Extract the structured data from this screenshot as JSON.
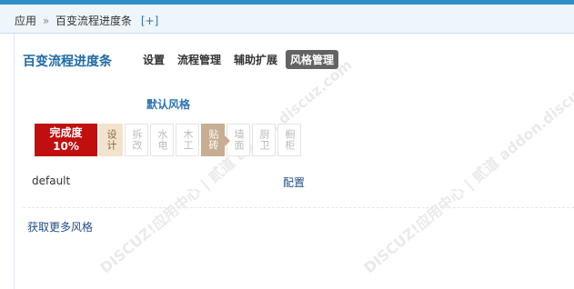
{
  "breadcrumb": {
    "root": "应用",
    "separator": "»",
    "current": "百变流程进度条",
    "add": "[+]"
  },
  "page_title": "百变流程进度条",
  "tabs": [
    {
      "label": "设置",
      "active": false
    },
    {
      "label": "流程管理",
      "active": false
    },
    {
      "label": "辅助扩展",
      "active": false
    },
    {
      "label": "风格管理",
      "active": true
    }
  ],
  "style_section": {
    "title": "默认风格",
    "progress_label": "完成度",
    "progress_value": "10%",
    "steps": [
      {
        "label": "设计",
        "state": "done"
      },
      {
        "label": "拆改",
        "state": "todo"
      },
      {
        "label": "水电",
        "state": "todo"
      },
      {
        "label": "木工",
        "state": "todo"
      },
      {
        "label": "贴砖",
        "state": "current"
      },
      {
        "label": "墙面",
        "state": "todo"
      },
      {
        "label": "厨卫",
        "state": "todo"
      },
      {
        "label": "橱柜",
        "state": "todo"
      }
    ],
    "style_name": "default",
    "config_label": "配置"
  },
  "more_styles_label": "获取更多风格",
  "watermark": "DISCUZ!应用中心 | 贰道 addon.discuz.com",
  "colors": {
    "accent": "#2f8fc7",
    "progress": "#c10e0e",
    "step_done": "#f2e3cd",
    "step_current": "#c7ad92",
    "tab_active": "#636363"
  }
}
